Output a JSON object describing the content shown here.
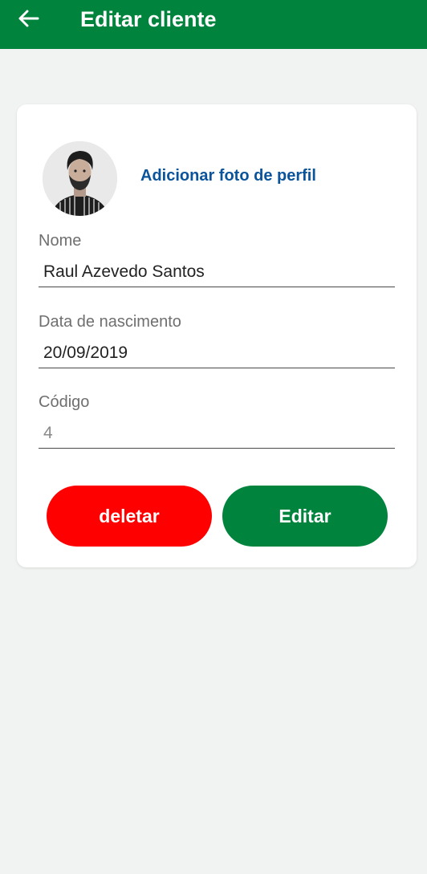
{
  "header": {
    "title": "Editar cliente",
    "back_icon": "arrow-left-icon",
    "color": "#00843d"
  },
  "profile": {
    "add_photo_label": "Adicionar foto de perfil"
  },
  "form": {
    "name_label": "Nome",
    "name_value": "Raul Azevedo Santos",
    "birth_label": "Data de nascimento",
    "birth_value": "20/09/2019",
    "code_label": "Código",
    "code_value": "4"
  },
  "actions": {
    "delete_label": "deletar",
    "delete_color": "#ff0000",
    "edit_label": "Editar",
    "edit_color": "#00843d"
  }
}
